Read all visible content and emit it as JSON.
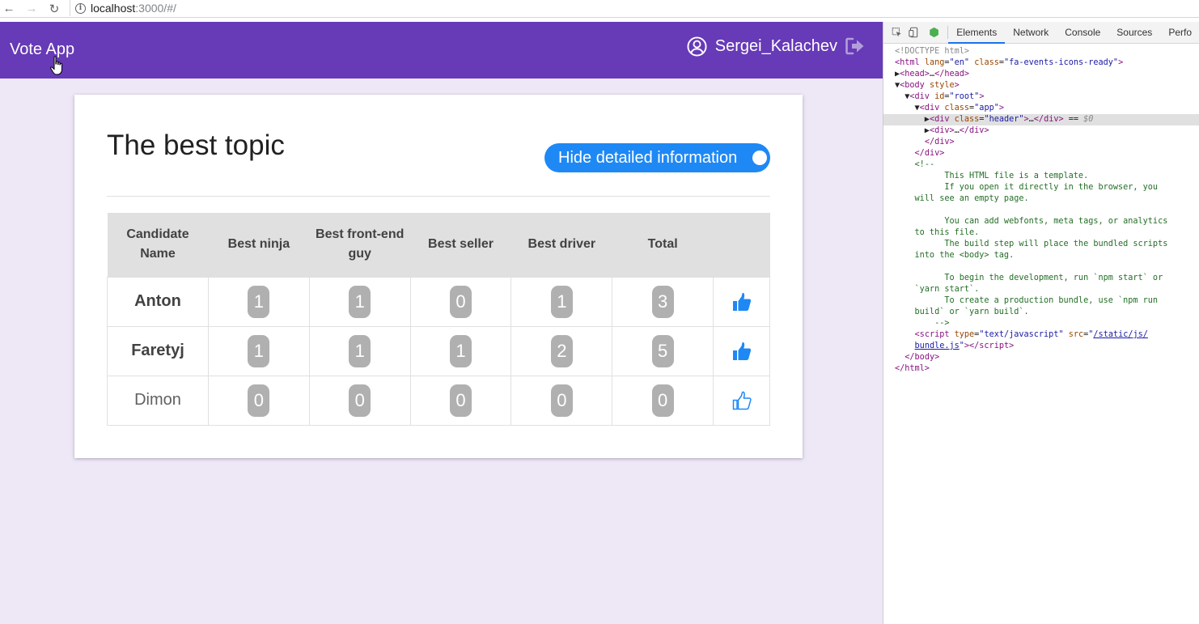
{
  "browser": {
    "url_host": "localhost",
    "url_rest": ":3000/#/"
  },
  "header": {
    "brand": "Vote App",
    "user_name": "Sergei_Kalachev"
  },
  "topic": {
    "title": "The best topic",
    "toggle_label": "Hide detailed information"
  },
  "table": {
    "columns": [
      "Candidate Name",
      "Best ninja",
      "Best front-end guy",
      "Best seller",
      "Best driver",
      "Total"
    ],
    "rows": [
      {
        "name": "Anton",
        "votes": [
          "1",
          "1",
          "0",
          "1"
        ],
        "total": "3",
        "voted": true
      },
      {
        "name": "Faretyj",
        "votes": [
          "1",
          "1",
          "1",
          "2"
        ],
        "total": "5",
        "voted": true
      },
      {
        "name": "Dimon",
        "votes": [
          "0",
          "0",
          "0",
          "0"
        ],
        "total": "0",
        "voted": false
      }
    ]
  },
  "devtools": {
    "tabs": [
      "Elements",
      "Network",
      "Console",
      "Sources",
      "Perfo"
    ],
    "active_tab": "Elements"
  },
  "colors": {
    "header": "#673ab7",
    "background": "#ede7f6",
    "toggle": "#1e88f5",
    "badge": "#b0b0b0",
    "thumb": "#1e88f5"
  },
  "icons": {
    "user": "user-circle-icon",
    "logout": "logout-icon",
    "vote": "thumbs-up-icon"
  }
}
